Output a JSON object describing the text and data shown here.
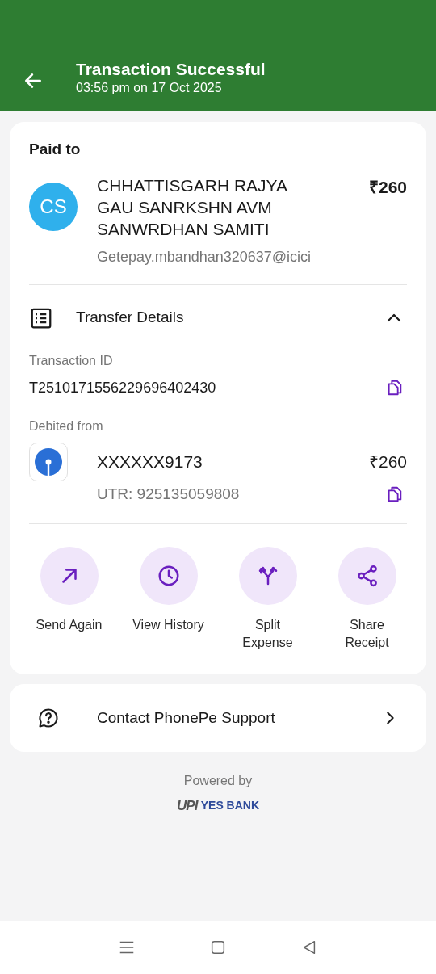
{
  "header": {
    "title": "Transaction Successful",
    "subtitle": "03:56 pm on 17 Oct 2025"
  },
  "paid_to": {
    "label": "Paid to",
    "initials": "CS",
    "name": "CHHATTISGARH RAJYA GAU SANRKSHN AVM SANWRDHAN SAMITI",
    "vpa": "Getepay.mbandhan320637@icici",
    "amount": "₹260"
  },
  "transfer_details": {
    "title": "Transfer Details",
    "expanded": true,
    "transaction_id_label": "Transaction ID",
    "transaction_id": "T2510171556229696402430",
    "debited_label": "Debited from",
    "account": "XXXXXX9173",
    "amount": "₹260",
    "utr": "UTR: 925135059808"
  },
  "actions": [
    {
      "kind": "send",
      "label": "Send Again"
    },
    {
      "kind": "history",
      "label": "View History"
    },
    {
      "kind": "split",
      "label": "Split Expense"
    },
    {
      "kind": "share",
      "label": "Share Receipt"
    }
  ],
  "support": {
    "label": "Contact PhonePe Support"
  },
  "footer": {
    "powered_by": "Powered by",
    "logos": [
      "UPI",
      "YES BANK"
    ]
  }
}
